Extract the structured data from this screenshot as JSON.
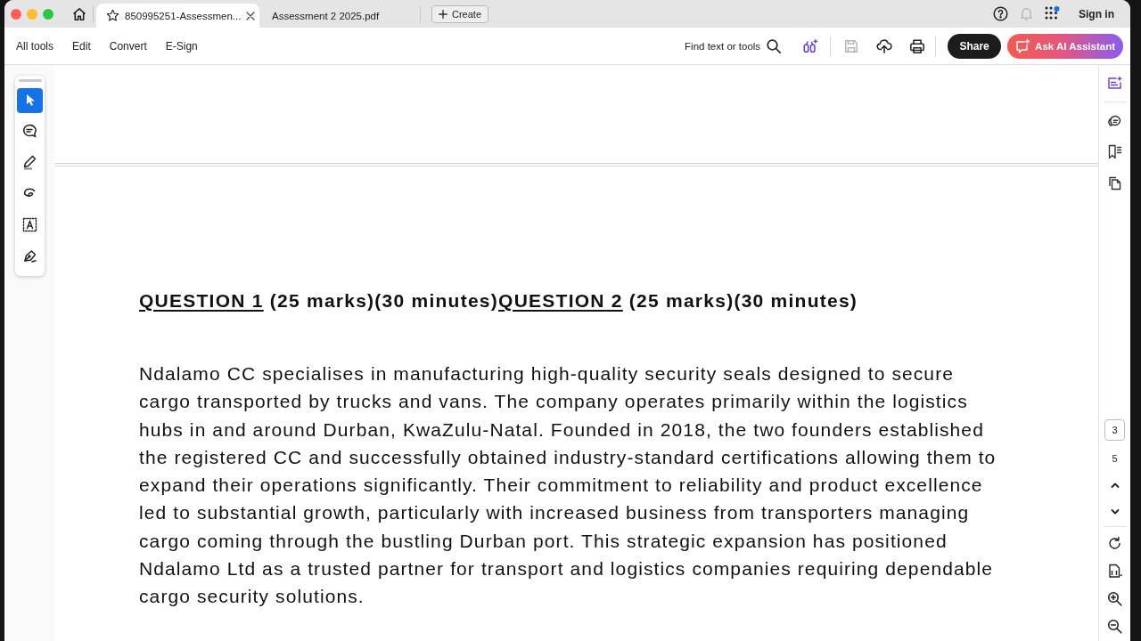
{
  "tab_bar": {
    "tabs": [
      {
        "label": "850995251-Assessmen...",
        "selected": true
      },
      {
        "label": "Assessment 2 2025.pdf",
        "selected": false
      }
    ],
    "create_button": "Create",
    "sign_in": "Sign in"
  },
  "menu": [
    "All tools",
    "Edit",
    "Convert",
    "E-Sign"
  ],
  "toolbar": {
    "search_label": "Find text or tools",
    "icons": [
      {
        "kind": "ai-tools",
        "disabled": false
      },
      {
        "kind": "save",
        "disabled": true
      },
      {
        "kind": "upload",
        "disabled": false
      },
      {
        "kind": "print",
        "disabled": false
      }
    ],
    "share_button": "Share",
    "ai_button": "Ask AI Assistant"
  },
  "tool_panel": [
    {
      "kind": "select",
      "selected": true
    },
    {
      "kind": "comment",
      "selected": false
    },
    {
      "kind": "highlight",
      "selected": false
    },
    {
      "kind": "draw",
      "selected": false
    },
    {
      "kind": "text",
      "selected": false
    },
    {
      "kind": "sign",
      "selected": false
    }
  ],
  "document": {
    "heading": [
      {
        "text": "QUESTION 1",
        "underlined": true
      },
      {
        "text": " (25 marks)(30 minutes)",
        "underlined": false
      },
      {
        "text": "QUESTION 2",
        "underlined": true
      },
      {
        "text": " (25 marks)(30 minutes)",
        "underlined": false
      }
    ],
    "paragraph": "Ndalamo CC specialises in manufacturing high-quality security seals designed to secure cargo transported by trucks and vans. The company operates primarily within the logistics hubs in and around Durban, KwaZulu-Natal. Founded in 2018, the two founders established the registered CC and successfully obtained industry-standard certifications allowing them to expand their operations significantly. Their commitment to reliability and product excellence led to substantial growth, particularly with increased business from transporters managing cargo coming through the bustling Durban port. This strategic expansion has positioned Ndalamo Ltd as a trusted partner for transport and logistics companies requiring dependable cargo security solutions."
  },
  "page_nav": {
    "current": "3",
    "total": "5"
  }
}
